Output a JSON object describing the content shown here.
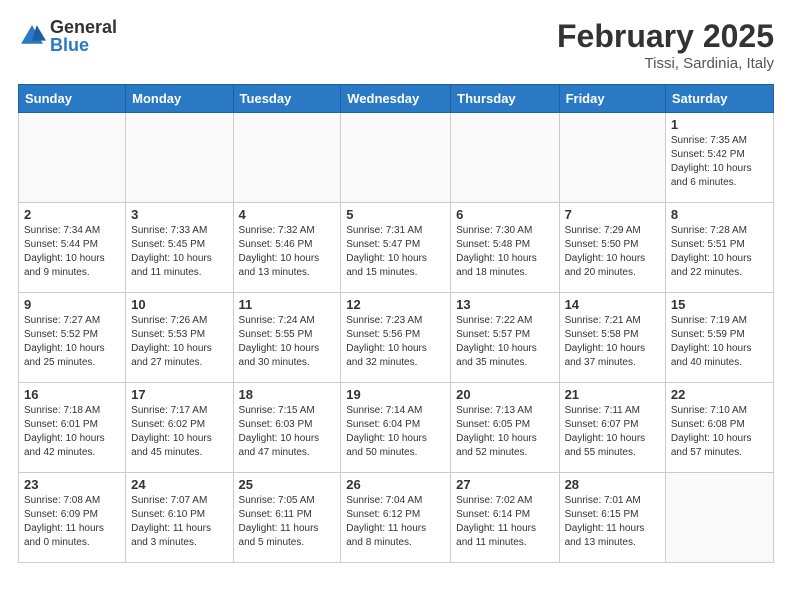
{
  "header": {
    "logo_general": "General",
    "logo_blue": "Blue",
    "main_title": "February 2025",
    "sub_title": "Tissi, Sardinia, Italy"
  },
  "weekdays": [
    "Sunday",
    "Monday",
    "Tuesday",
    "Wednesday",
    "Thursday",
    "Friday",
    "Saturday"
  ],
  "weeks": [
    [
      {
        "day": "",
        "info": ""
      },
      {
        "day": "",
        "info": ""
      },
      {
        "day": "",
        "info": ""
      },
      {
        "day": "",
        "info": ""
      },
      {
        "day": "",
        "info": ""
      },
      {
        "day": "",
        "info": ""
      },
      {
        "day": "1",
        "info": "Sunrise: 7:35 AM\nSunset: 5:42 PM\nDaylight: 10 hours and 6 minutes."
      }
    ],
    [
      {
        "day": "2",
        "info": "Sunrise: 7:34 AM\nSunset: 5:44 PM\nDaylight: 10 hours and 9 minutes."
      },
      {
        "day": "3",
        "info": "Sunrise: 7:33 AM\nSunset: 5:45 PM\nDaylight: 10 hours and 11 minutes."
      },
      {
        "day": "4",
        "info": "Sunrise: 7:32 AM\nSunset: 5:46 PM\nDaylight: 10 hours and 13 minutes."
      },
      {
        "day": "5",
        "info": "Sunrise: 7:31 AM\nSunset: 5:47 PM\nDaylight: 10 hours and 15 minutes."
      },
      {
        "day": "6",
        "info": "Sunrise: 7:30 AM\nSunset: 5:48 PM\nDaylight: 10 hours and 18 minutes."
      },
      {
        "day": "7",
        "info": "Sunrise: 7:29 AM\nSunset: 5:50 PM\nDaylight: 10 hours and 20 minutes."
      },
      {
        "day": "8",
        "info": "Sunrise: 7:28 AM\nSunset: 5:51 PM\nDaylight: 10 hours and 22 minutes."
      }
    ],
    [
      {
        "day": "9",
        "info": "Sunrise: 7:27 AM\nSunset: 5:52 PM\nDaylight: 10 hours and 25 minutes."
      },
      {
        "day": "10",
        "info": "Sunrise: 7:26 AM\nSunset: 5:53 PM\nDaylight: 10 hours and 27 minutes."
      },
      {
        "day": "11",
        "info": "Sunrise: 7:24 AM\nSunset: 5:55 PM\nDaylight: 10 hours and 30 minutes."
      },
      {
        "day": "12",
        "info": "Sunrise: 7:23 AM\nSunset: 5:56 PM\nDaylight: 10 hours and 32 minutes."
      },
      {
        "day": "13",
        "info": "Sunrise: 7:22 AM\nSunset: 5:57 PM\nDaylight: 10 hours and 35 minutes."
      },
      {
        "day": "14",
        "info": "Sunrise: 7:21 AM\nSunset: 5:58 PM\nDaylight: 10 hours and 37 minutes."
      },
      {
        "day": "15",
        "info": "Sunrise: 7:19 AM\nSunset: 5:59 PM\nDaylight: 10 hours and 40 minutes."
      }
    ],
    [
      {
        "day": "16",
        "info": "Sunrise: 7:18 AM\nSunset: 6:01 PM\nDaylight: 10 hours and 42 minutes."
      },
      {
        "day": "17",
        "info": "Sunrise: 7:17 AM\nSunset: 6:02 PM\nDaylight: 10 hours and 45 minutes."
      },
      {
        "day": "18",
        "info": "Sunrise: 7:15 AM\nSunset: 6:03 PM\nDaylight: 10 hours and 47 minutes."
      },
      {
        "day": "19",
        "info": "Sunrise: 7:14 AM\nSunset: 6:04 PM\nDaylight: 10 hours and 50 minutes."
      },
      {
        "day": "20",
        "info": "Sunrise: 7:13 AM\nSunset: 6:05 PM\nDaylight: 10 hours and 52 minutes."
      },
      {
        "day": "21",
        "info": "Sunrise: 7:11 AM\nSunset: 6:07 PM\nDaylight: 10 hours and 55 minutes."
      },
      {
        "day": "22",
        "info": "Sunrise: 7:10 AM\nSunset: 6:08 PM\nDaylight: 10 hours and 57 minutes."
      }
    ],
    [
      {
        "day": "23",
        "info": "Sunrise: 7:08 AM\nSunset: 6:09 PM\nDaylight: 11 hours and 0 minutes."
      },
      {
        "day": "24",
        "info": "Sunrise: 7:07 AM\nSunset: 6:10 PM\nDaylight: 11 hours and 3 minutes."
      },
      {
        "day": "25",
        "info": "Sunrise: 7:05 AM\nSunset: 6:11 PM\nDaylight: 11 hours and 5 minutes."
      },
      {
        "day": "26",
        "info": "Sunrise: 7:04 AM\nSunset: 6:12 PM\nDaylight: 11 hours and 8 minutes."
      },
      {
        "day": "27",
        "info": "Sunrise: 7:02 AM\nSunset: 6:14 PM\nDaylight: 11 hours and 11 minutes."
      },
      {
        "day": "28",
        "info": "Sunrise: 7:01 AM\nSunset: 6:15 PM\nDaylight: 11 hours and 13 minutes."
      },
      {
        "day": "",
        "info": ""
      }
    ]
  ]
}
